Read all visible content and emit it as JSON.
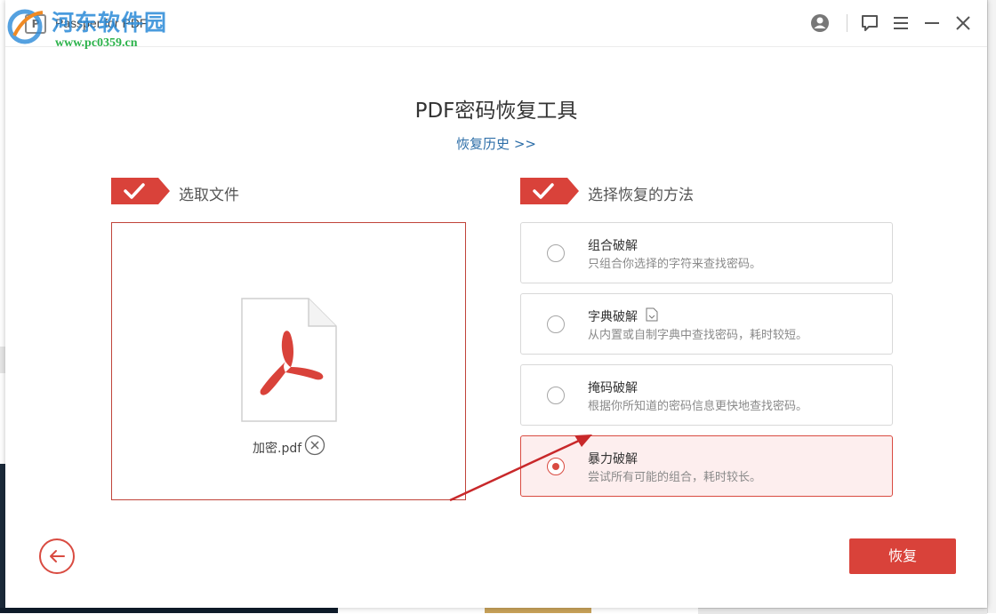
{
  "titlebar": {
    "app_title": "Passper for PDF",
    "logo_letter": "P"
  },
  "watermark": {
    "site_name": "河东软件园",
    "url": "www.pc0359.cn"
  },
  "main": {
    "title": "PDF密码恢复工具",
    "history_link": "恢复历史 >>"
  },
  "step1": {
    "label": "选取文件",
    "file_name": "加密.pdf"
  },
  "step2": {
    "label": "选择恢复的方法",
    "methods": [
      {
        "title": "组合破解",
        "desc": "只组合你选择的字符来查找密码。",
        "selected": false
      },
      {
        "title": "字典破解",
        "desc": "从内置或自制字典中查找密码，耗时较短。",
        "selected": false
      },
      {
        "title": "掩码破解",
        "desc": "根据你所知道的密码信息更快地查找密码。",
        "selected": false
      },
      {
        "title": "暴力破解",
        "desc": "尝试所有可能的组合，耗时较长。",
        "selected": true
      }
    ]
  },
  "footer": {
    "recover_label": "恢复"
  },
  "colors": {
    "accent": "#d9423a",
    "selected_bg": "#fdeeee",
    "link": "#2d6ea8"
  },
  "icons": [
    "account-icon",
    "feedback-icon",
    "menu-icon",
    "minimize-icon",
    "close-icon",
    "check-icon",
    "pdf-file-icon",
    "remove-file-icon",
    "dictionary-file-icon",
    "back-arrow-icon"
  ]
}
